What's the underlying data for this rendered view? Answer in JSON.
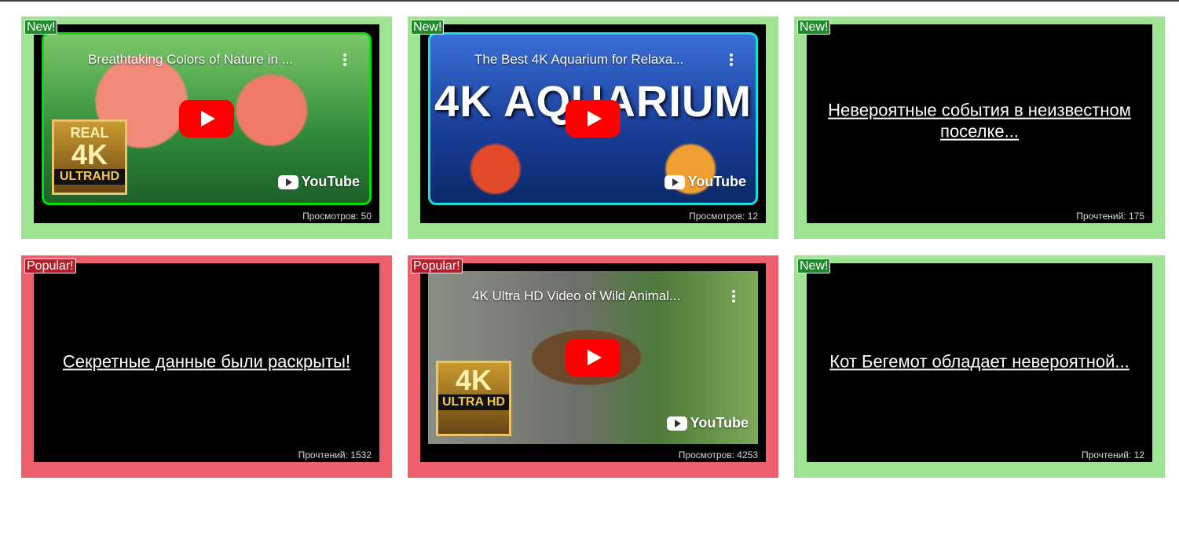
{
  "cards": [
    {
      "badge": "New!",
      "type": "video",
      "title": "Breathtaking Colors of Nature in ...",
      "stat": "Просмотров: 50",
      "youtube_label": "YouTube",
      "overlay_badge": {
        "line1": "REAL",
        "line2": "4K",
        "line3": "ULTRAHD"
      }
    },
    {
      "badge": "New!",
      "type": "video",
      "title": "The Best 4K Aquarium for Relaxa...",
      "stat": "Просмотров: 12",
      "youtube_label": "YouTube",
      "big_text": "4K AQUARIUM"
    },
    {
      "badge": "New!",
      "type": "article",
      "title": "Невероятные события в неизвестном поселке...",
      "stat": "Прочтений: 175"
    },
    {
      "badge": "Popular!",
      "type": "article",
      "title": "Секретные данные были раскрыты!",
      "stat": "Прочтений: 1532"
    },
    {
      "badge": "Popular!",
      "type": "video",
      "title": "4K Ultra HD Video of Wild Animal...",
      "stat": "Просмотров: 4253",
      "youtube_label": "YouTube",
      "overlay_badge": {
        "line1": "",
        "line2": "4K",
        "line3": "ULTRA HD"
      }
    },
    {
      "badge": "New!",
      "type": "article",
      "title": "Кот Бегемот обладает невероятной...",
      "stat": "Прочтений: 12"
    }
  ],
  "colors": {
    "new_card": "#9ee392",
    "popular_card": "#ef5f6b",
    "new_badge": "#1f8a2c",
    "popular_badge": "#b31e2a",
    "youtube_red": "#ff0000"
  }
}
